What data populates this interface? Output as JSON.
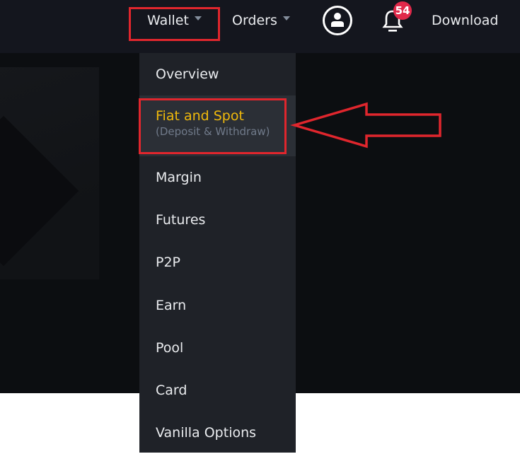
{
  "header": {
    "nav": [
      {
        "label": "Wallet",
        "has_dropdown": true,
        "highlighted": true
      },
      {
        "label": "Orders",
        "has_dropdown": true,
        "highlighted": false
      }
    ],
    "account_icon": "user-circle-icon",
    "notifications": {
      "icon": "bell-icon",
      "count": "54"
    },
    "download_label": "Download"
  },
  "wallet_menu": {
    "items": [
      {
        "label": "Overview"
      },
      {
        "label": "Fiat and Spot",
        "sublabel": "(Deposit & Withdraw)",
        "active": true,
        "highlighted": true
      },
      {
        "label": "Margin"
      },
      {
        "label": "Futures"
      },
      {
        "label": "P2P"
      },
      {
        "label": "Earn"
      },
      {
        "label": "Pool"
      },
      {
        "label": "Card"
      },
      {
        "label": "Vanilla Options"
      }
    ]
  },
  "annotation": {
    "arrow_color": "#e0262d",
    "points_to": "Fiat and Spot"
  },
  "colors": {
    "accent": "#f0b90b",
    "header_bg": "#14161e",
    "menu_bg": "#1f2228",
    "annotation": "#e0262d",
    "badge": "#e0294a"
  }
}
